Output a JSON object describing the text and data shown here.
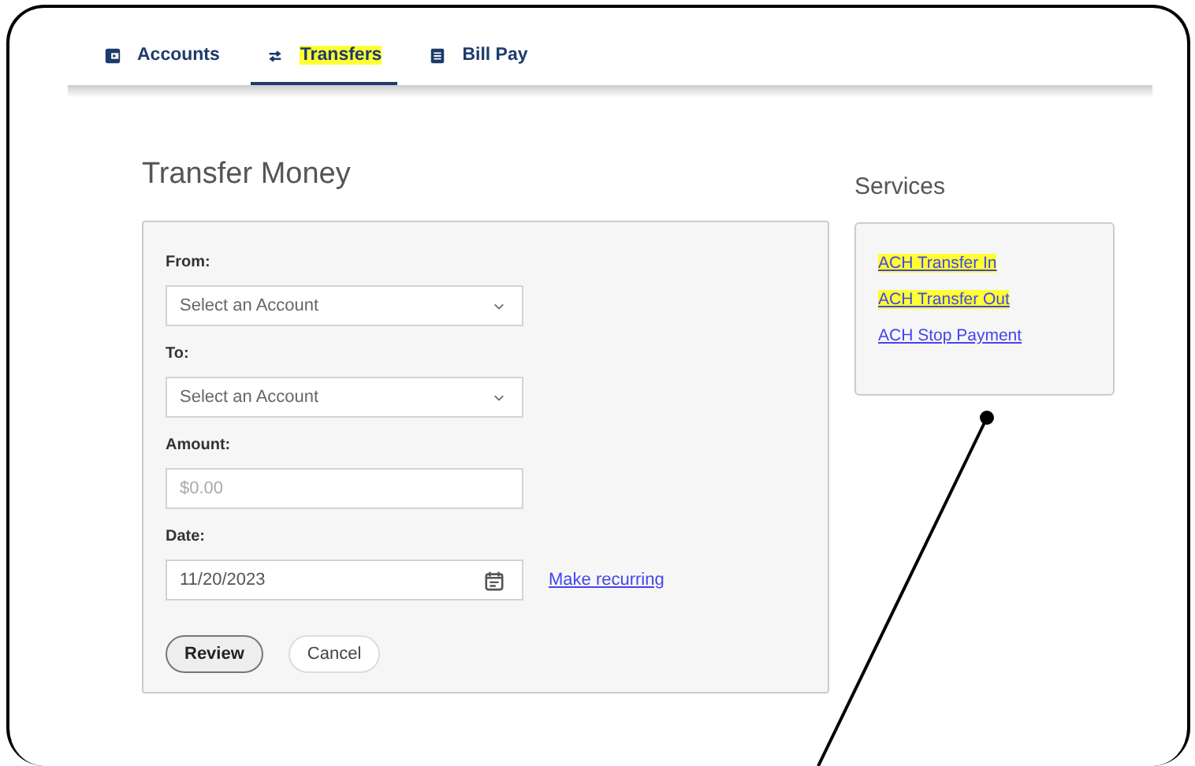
{
  "tabs": [
    {
      "label": "Accounts",
      "kind": "wallet",
      "selected": false,
      "highlighted": false
    },
    {
      "label": "Transfers",
      "kind": "arrows",
      "selected": true,
      "highlighted": true
    },
    {
      "label": "Bill Pay",
      "kind": "list",
      "selected": false,
      "highlighted": false
    }
  ],
  "transfer_form": {
    "title": "Transfer Money",
    "fields": [
      {
        "label": "From:",
        "kind": "select",
        "value": "Select an Account"
      },
      {
        "label": "To:",
        "kind": "select",
        "value": "Select an Account"
      },
      {
        "label": "Amount:",
        "kind": "input",
        "placeholder": "$0.00"
      },
      {
        "label": "Date:",
        "kind": "date",
        "value": "11/20/2023",
        "link": "Make recurring"
      }
    ],
    "buttons": [
      {
        "label": "Review",
        "kind": "primary"
      },
      {
        "label": "Cancel",
        "kind": "secondary"
      }
    ]
  },
  "services": {
    "title": "Services",
    "links": [
      {
        "label": "ACH Transfer In",
        "highlighted": true
      },
      {
        "label": "ACH Transfer Out",
        "highlighted": true
      },
      {
        "label": "ACH Stop Payment",
        "highlighted": false
      }
    ]
  }
}
